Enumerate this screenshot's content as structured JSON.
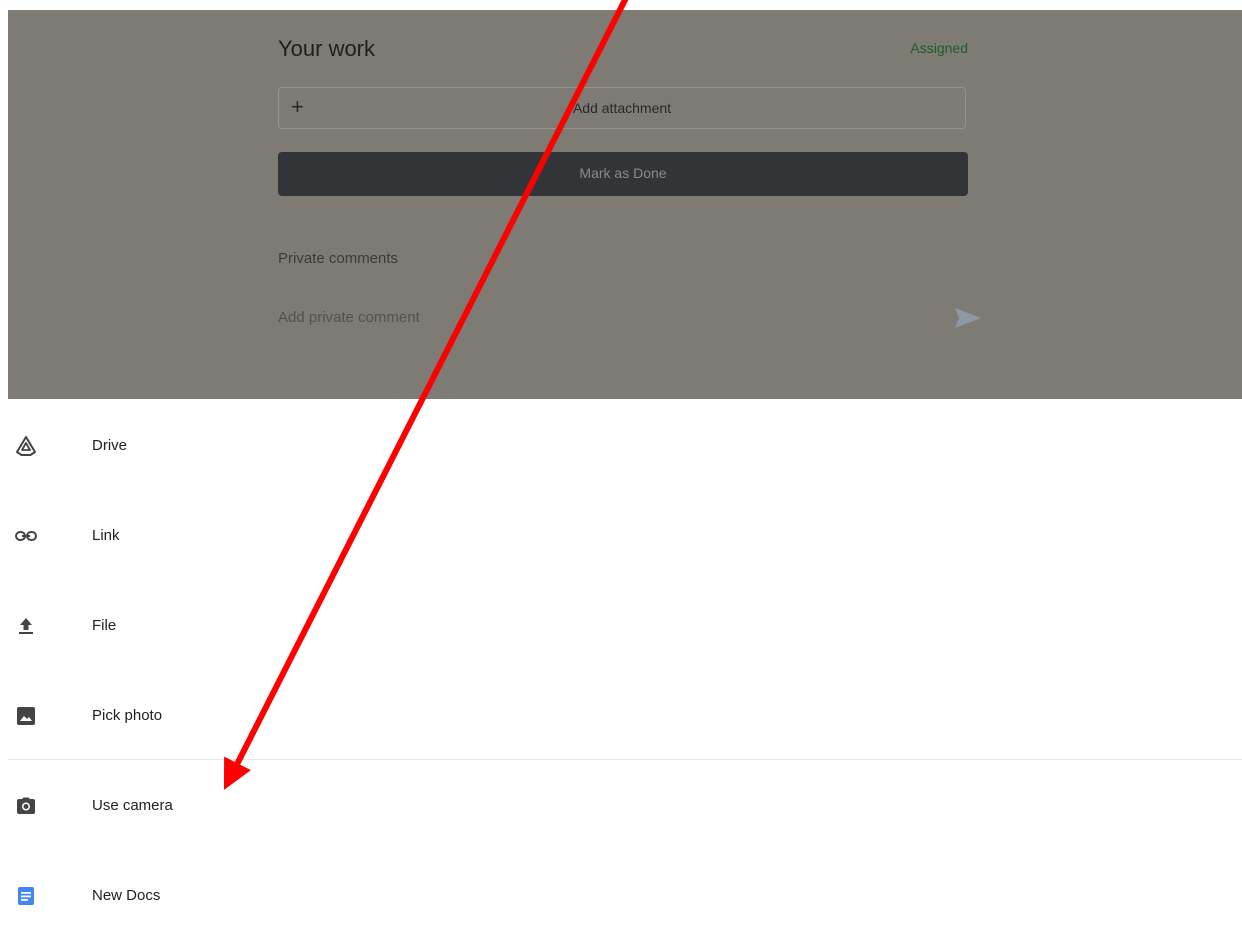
{
  "work": {
    "title": "Your work",
    "status": "Assigned",
    "add_attachment_label": "Add attachment",
    "mark_done_label": "Mark as Done",
    "private_comments_label": "Private comments",
    "private_comment_placeholder": "Add private comment"
  },
  "attach_menu": {
    "items": [
      {
        "label": "Drive",
        "icon": "drive-icon"
      },
      {
        "label": "Link",
        "icon": "link-icon"
      },
      {
        "label": "File",
        "icon": "upload-icon"
      },
      {
        "label": "Pick photo",
        "icon": "image-icon"
      },
      {
        "label": "Use camera",
        "icon": "camera-icon"
      },
      {
        "label": "New Docs",
        "icon": "docs-icon"
      }
    ]
  },
  "colors": {
    "overlay": "#7e7a74",
    "status_green": "#1b5e2a",
    "annotation_arrow": "#ff0000",
    "docs_blue": "#4285f4"
  }
}
